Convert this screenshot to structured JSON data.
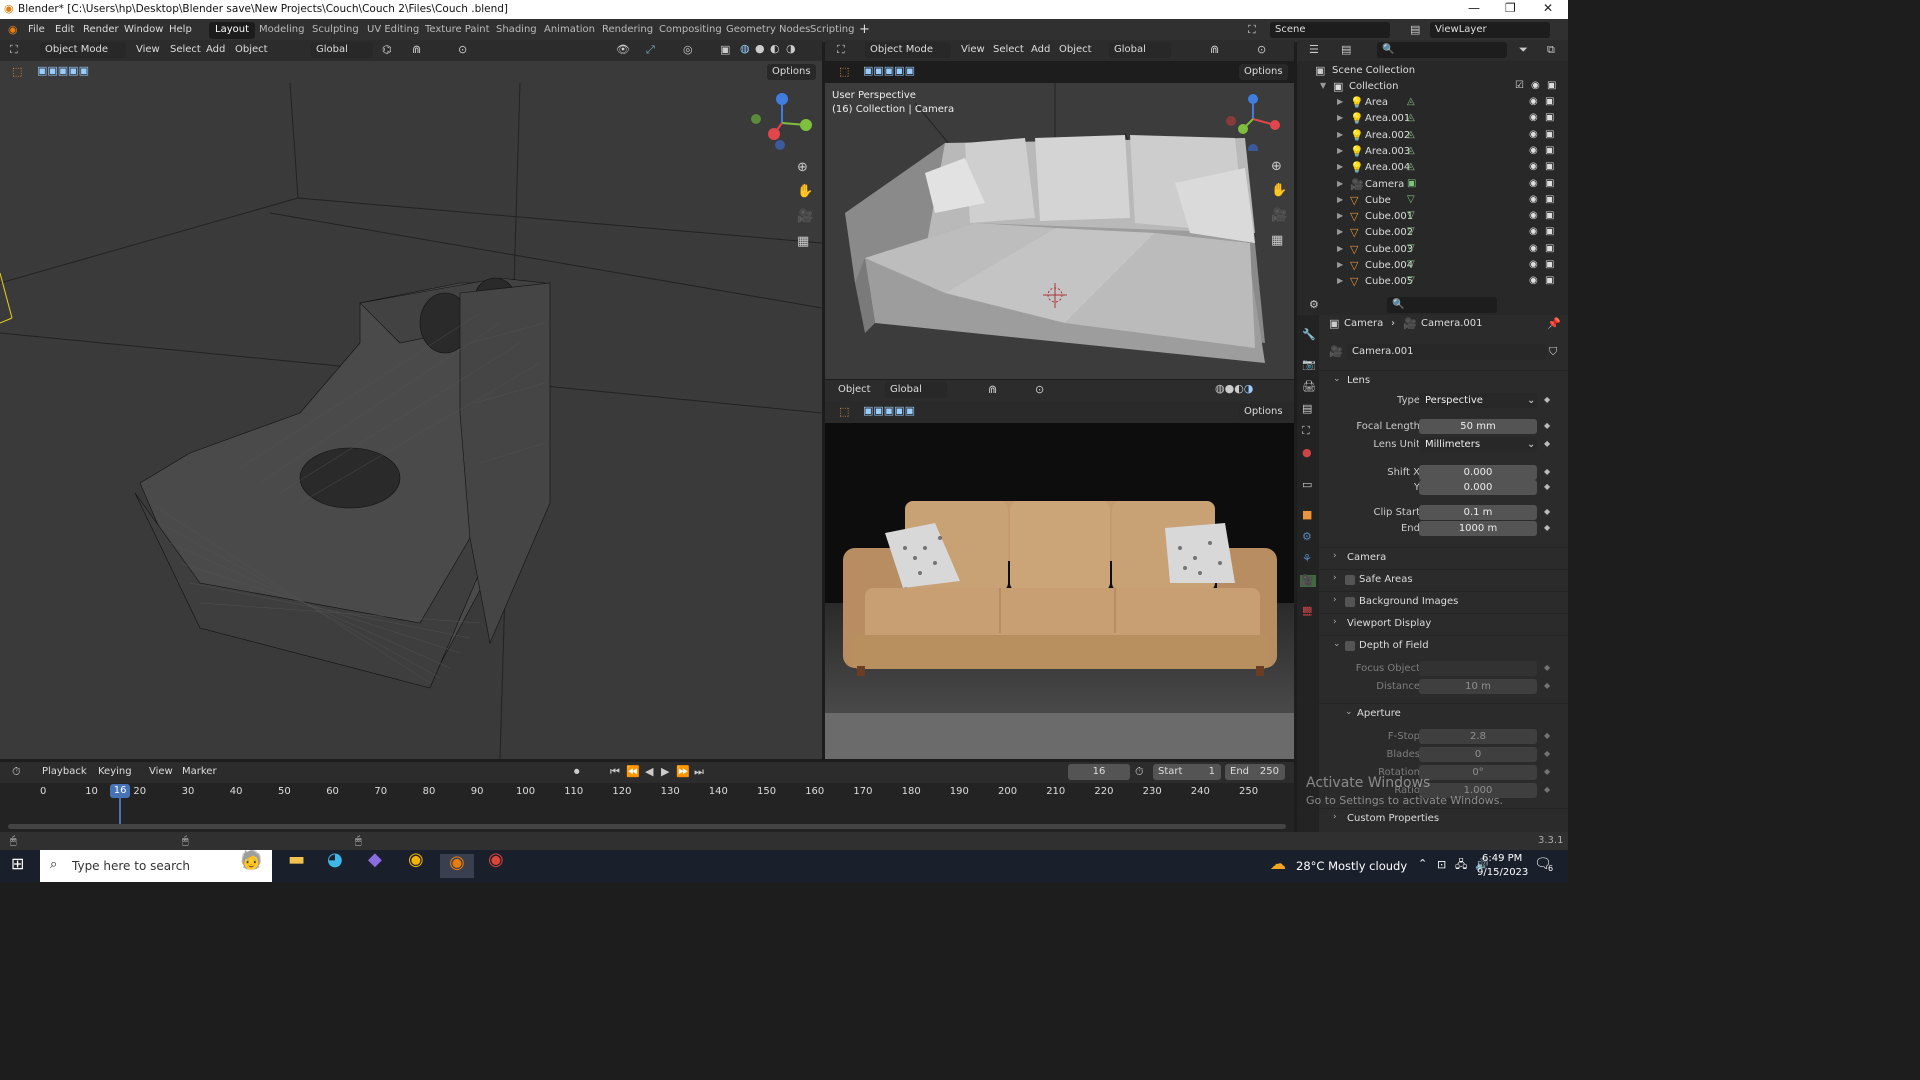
{
  "window": {
    "title": "Blender* [C:\\Users\\hp\\Desktop\\Blender save\\New Projects\\Couch\\Couch 2\\Files\\Couch .blend]"
  },
  "menu": {
    "file": "File",
    "edit": "Edit",
    "render": "Render",
    "window": "Window",
    "help": "Help"
  },
  "workspaces": [
    "Layout",
    "Modeling",
    "Sculpting",
    "UV Editing",
    "Texture Paint",
    "Shading",
    "Animation",
    "Rendering",
    "Compositing",
    "Geometry Nodes",
    "Scripting"
  ],
  "scene": {
    "name": "Scene",
    "view_layer": "ViewLayer"
  },
  "vp1": {
    "mode": "Object Mode",
    "view": "View",
    "select": "Select",
    "add": "Add",
    "object": "Object",
    "orient": "Global",
    "options": "Options"
  },
  "vp2": {
    "mode": "Object Mode",
    "view": "View",
    "select": "Select",
    "add": "Add",
    "object": "Object",
    "orient": "Global",
    "options": "Options",
    "overlay1": "User Perspective",
    "overlay2": "(16) Collection | Camera"
  },
  "vp3": {
    "object": "Object",
    "orient": "Global",
    "options": "Options"
  },
  "outliner": {
    "scene_collection": "Scene Collection",
    "collection": "Collection",
    "items": [
      "Area",
      "Area.001",
      "Area.002",
      "Area.003",
      "Area.004",
      "Camera",
      "Cube",
      "Cube.001",
      "Cube.002",
      "Cube.003",
      "Cube.004",
      "Cube.005"
    ]
  },
  "props": {
    "crumb_obj": "Camera",
    "crumb_data": "Camera.001",
    "datablock": "Camera.001",
    "lens": "Lens",
    "type_label": "Type",
    "type_value": "Perspective",
    "focal_label": "Focal Length",
    "focal_value": "50 mm",
    "lens_unit_label": "Lens Unit",
    "lens_unit_value": "Millimeters",
    "shiftx_label": "Shift X",
    "shiftx_value": "0.000",
    "shifty_label": "Y",
    "shifty_value": "0.000",
    "clip_start_label": "Clip Start",
    "clip_start_value": "0.1 m",
    "clip_end_label": "End",
    "clip_end_value": "1000 m",
    "camera": "Camera",
    "safe_areas": "Safe Areas",
    "bg_images": "Background Images",
    "viewport_display": "Viewport Display",
    "dof": "Depth of Field",
    "focus_object": "Focus Object",
    "distance_label": "Distance",
    "distance_value": "10 m",
    "aperture": "Aperture",
    "fstop_label": "F-Stop",
    "fstop_value": "2.8",
    "blades_label": "Blades",
    "blades_value": "0",
    "rotation_label": "Rotation",
    "rotation_value": "0°",
    "ratio_label": "Ratio",
    "ratio_value": "1.000",
    "custom_props": "Custom Properties"
  },
  "timeline": {
    "playback": "Playback",
    "keying": "Keying",
    "view": "View",
    "marker": "Marker",
    "current_frame": "16",
    "start_label": "Start",
    "start": "1",
    "end_label": "End",
    "end": "250",
    "ticks": [
      "0",
      "10",
      "20",
      "30",
      "40",
      "50",
      "60",
      "70",
      "80",
      "90",
      "100",
      "110",
      "120",
      "130",
      "140",
      "150",
      "160",
      "170",
      "180",
      "190",
      "200",
      "210",
      "220",
      "230",
      "240",
      "250"
    ],
    "playhead": "16"
  },
  "watermark": {
    "line1": "Activate Windows",
    "line2": "Go to Settings to activate Windows."
  },
  "status": {
    "version": "3.3.1"
  },
  "taskbar": {
    "search_placeholder": "Type here to search",
    "weather": "28°C  Mostly cloudy",
    "time": "6:49 PM",
    "date": "9/15/2023",
    "notif": "6"
  },
  "colors": {
    "accent": "#4772b3",
    "axis_x": "#e0464b",
    "axis_y": "#7fbf3e",
    "axis_z": "#3f7ee0"
  }
}
